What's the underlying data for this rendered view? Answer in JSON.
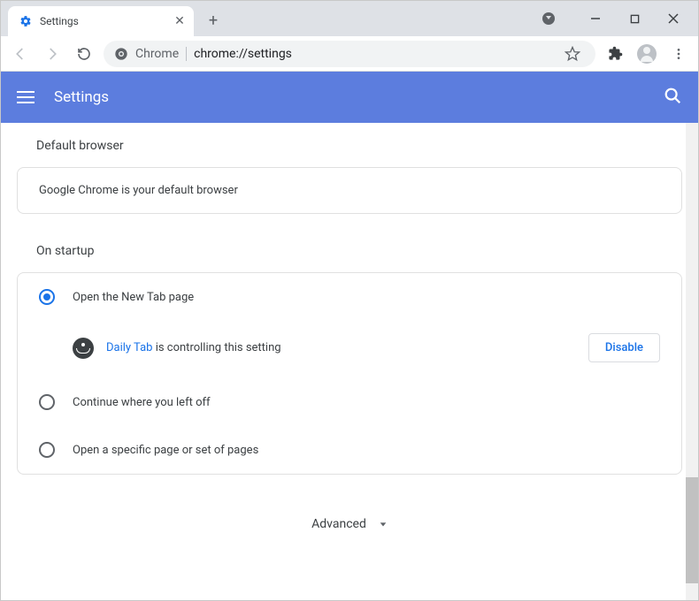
{
  "tab": {
    "title": "Settings"
  },
  "omnibox": {
    "prefix": "Chrome",
    "url": "chrome://settings"
  },
  "header": {
    "title": "Settings"
  },
  "sections": {
    "default_browser": {
      "title": "Default browser",
      "message": "Google Chrome is your default browser"
    },
    "on_startup": {
      "title": "On startup",
      "options": [
        "Open the New Tab page",
        "Continue where you left off",
        "Open a specific page or set of pages"
      ],
      "controlled": {
        "extension_name": "Daily Tab",
        "suffix": " is controlling this setting",
        "disable_label": "Disable"
      }
    }
  },
  "advanced": {
    "label": "Advanced"
  }
}
